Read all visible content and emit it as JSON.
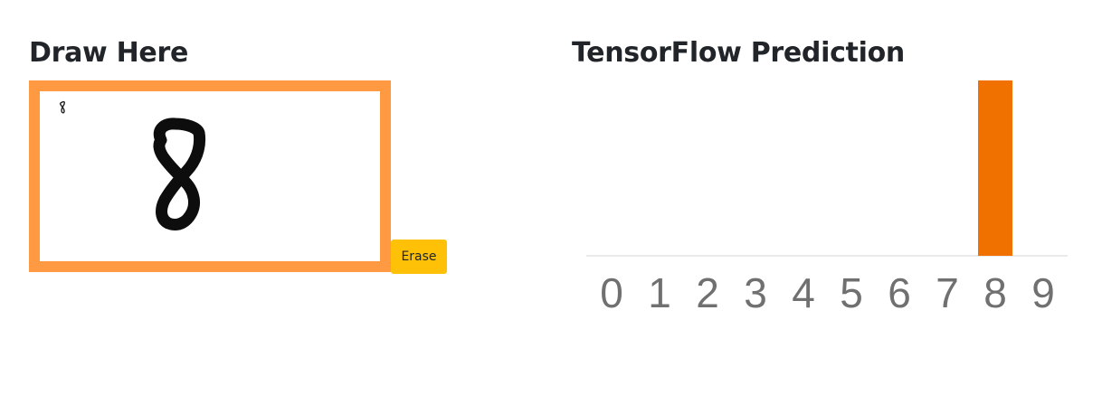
{
  "draw_panel": {
    "title": "Draw Here",
    "erase_label": "Erase",
    "thumbnail_digit": "8"
  },
  "prediction_panel": {
    "title": "TensorFlow Prediction"
  },
  "colors": {
    "canvas_border": "#ff9a42",
    "bar": "#f07000",
    "erase_button": "#ffc107",
    "tick_text": "#707070"
  },
  "chart_data": {
    "type": "bar",
    "categories": [
      "0",
      "1",
      "2",
      "3",
      "4",
      "5",
      "6",
      "7",
      "8",
      "9"
    ],
    "values": [
      0,
      0,
      0,
      0,
      0,
      0,
      0,
      0,
      1,
      0
    ],
    "title": "",
    "xlabel": "",
    "ylabel": "",
    "ylim": [
      0,
      1
    ],
    "grid": false,
    "legend": "none"
  }
}
